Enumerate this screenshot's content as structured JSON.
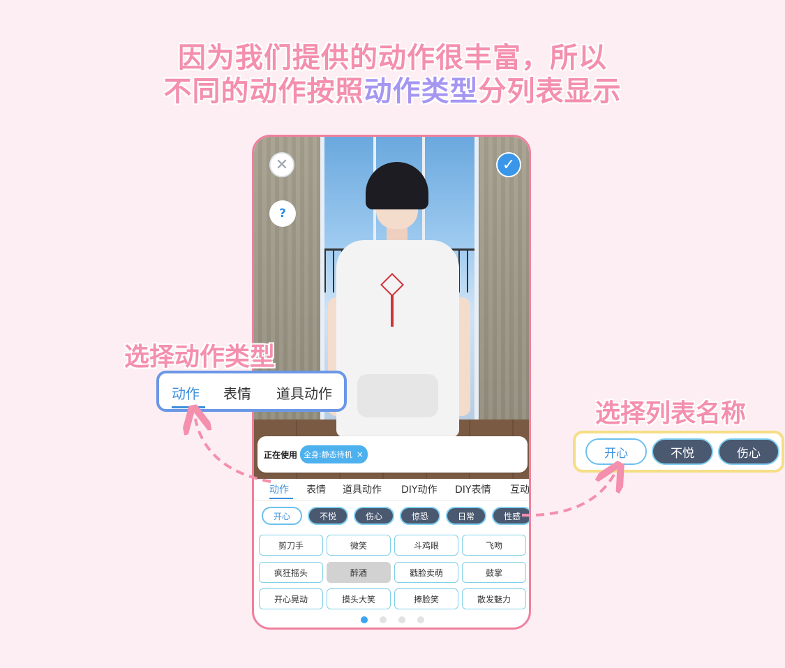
{
  "headline": {
    "line1": "因为我们提供的动作很丰富，所以",
    "line2_pre": "不同的动作按照",
    "line2_highlight": "动作类型",
    "line2_post": "分列表显示"
  },
  "callouts": {
    "left_label": "选择动作类型",
    "right_label": "选择列表名称",
    "left_tabs": [
      "动作",
      "表情",
      "道具动作"
    ],
    "right_chips": [
      "开心",
      "不悦",
      "伤心"
    ]
  },
  "phone": {
    "close_icon": "✕",
    "confirm_icon": "✓",
    "help_icon": "?",
    "using_label": "正在使用",
    "using_chip": "全身:静态待机",
    "using_chip_close": "×",
    "tabs": [
      "动作",
      "表情",
      "道具动作",
      "DIY动作",
      "DIY表情",
      "互动"
    ],
    "active_tab": "动作",
    "categories": [
      "开心",
      "不悦",
      "伤心",
      "惊恐",
      "日常",
      "性感"
    ],
    "active_category": "开心",
    "actions": [
      [
        "剪刀手",
        "微笑",
        "斗鸡眼",
        "飞吻"
      ],
      [
        "疯狂摇头",
        "醉酒",
        "戳脸卖萌",
        "鼓掌"
      ],
      [
        "开心晃动",
        "摸头大笑",
        "捧脸笑",
        "散发魅力"
      ]
    ],
    "disabled_action": "醉酒",
    "page_count": 4,
    "current_page": 1
  },
  "colors": {
    "accent_pink": "#f48fae",
    "highlight_purple": "#a596f2",
    "tab_blue": "#3c8fdb",
    "chip_dark": "#4a5870",
    "border_blue": "#6b97e6",
    "border_yellow": "#f5de86"
  }
}
